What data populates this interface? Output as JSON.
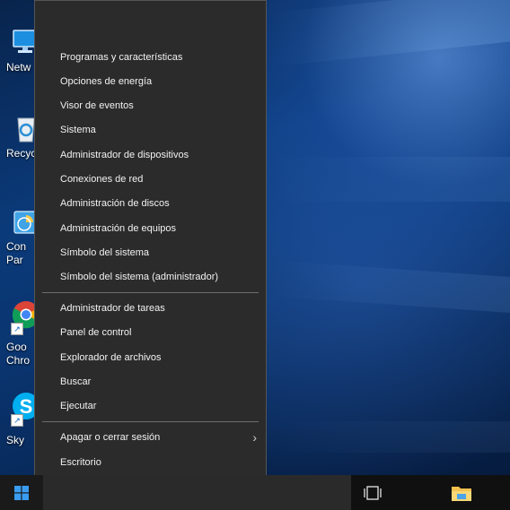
{
  "desktop": {
    "icons": [
      {
        "label": "Netw",
        "icon": "network-icon"
      },
      {
        "label": "Recycl",
        "icon": "recycle-bin-icon"
      },
      {
        "label_line1": "Con",
        "label_line2": "Par",
        "icon": "control-panel-icon"
      },
      {
        "label_line1": "Goo",
        "label_line2": "Chro",
        "icon": "chrome-icon"
      },
      {
        "label": "Sky",
        "icon": "skype-icon"
      }
    ]
  },
  "context_menu": {
    "items": [
      {
        "label": "Programas y características"
      },
      {
        "label": "Opciones de energía"
      },
      {
        "label": "Visor de eventos"
      },
      {
        "label": "Sistema"
      },
      {
        "label": "Administrador de dispositivos"
      },
      {
        "label": "Conexiones de red"
      },
      {
        "label": "Administración de discos"
      },
      {
        "label": "Administración de equipos"
      },
      {
        "label": "Símbolo del sistema"
      },
      {
        "label": "Símbolo del sistema (administrador)"
      },
      {
        "label": "Administrador de tareas"
      },
      {
        "label": "Panel de control"
      },
      {
        "label": "Explorador de archivos"
      },
      {
        "label": "Buscar"
      },
      {
        "label": "Ejecutar"
      },
      {
        "label": "Apagar o cerrar sesión",
        "submenu": true
      },
      {
        "label": "Escritorio"
      }
    ]
  },
  "taskbar": {
    "start_icon": "windows-logo-icon",
    "task_view_icon": "task-view-icon",
    "file_explorer_icon": "folder-icon"
  },
  "colors": {
    "menu_bg": "#2b2b2b",
    "taskbar_bg": "#101010",
    "accent": "#0078d7"
  }
}
